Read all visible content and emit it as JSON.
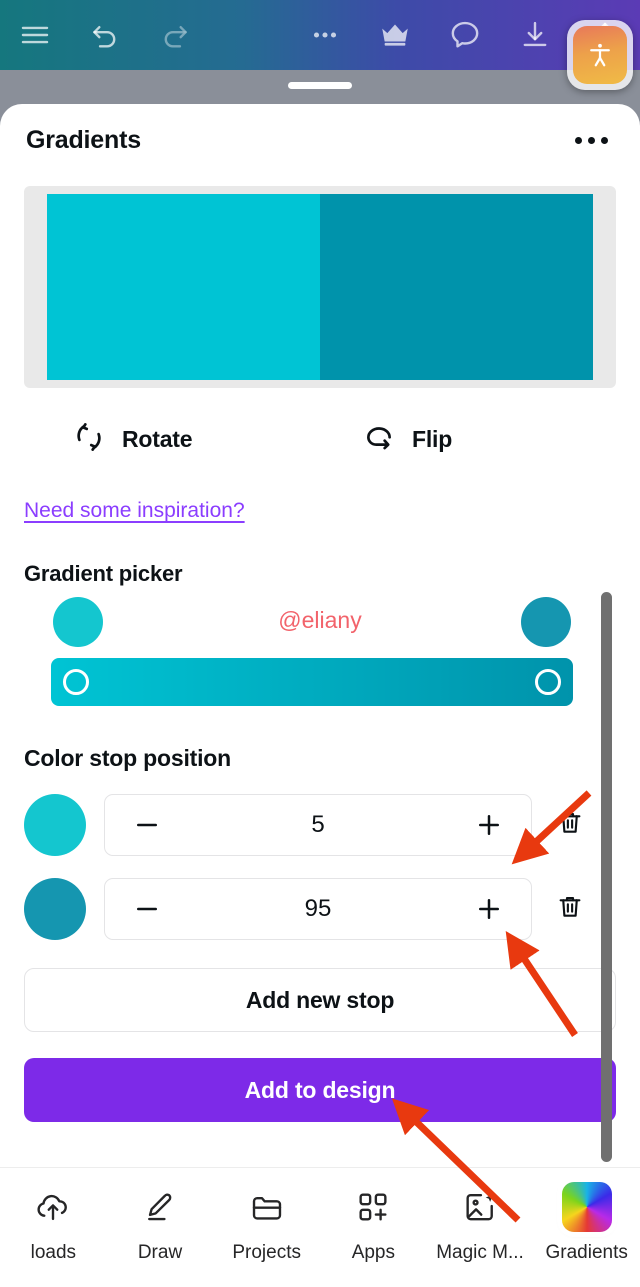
{
  "toolbar": {
    "items": [
      {
        "name": "menu-icon",
        "label": "Menu"
      },
      {
        "name": "undo-icon",
        "label": "Undo"
      },
      {
        "name": "redo-icon",
        "label": "Redo"
      },
      {
        "name": "more-options-icon",
        "label": "More options"
      },
      {
        "name": "crown-icon",
        "label": "Pro"
      },
      {
        "name": "comment-icon",
        "label": "Comments"
      },
      {
        "name": "download-icon",
        "label": "Download"
      },
      {
        "name": "share-icon",
        "label": "Share"
      }
    ],
    "gradient_left": "#15777e",
    "gradient_right": "#5b3bb5"
  },
  "accessibility_fab": {
    "name": "accessibility-button",
    "label": "Accessibility"
  },
  "panel": {
    "title": "Gradients",
    "more_label": "More"
  },
  "preview": {
    "color_left": "#00c4d4",
    "color_right": "#0093ab",
    "hard_stop_percent": 50
  },
  "transform": {
    "rotate_label": "Rotate",
    "flip_label": "Flip"
  },
  "inspiration": {
    "link_text": "Need some inspiration?",
    "color": "#8b3dff"
  },
  "gradient_picker": {
    "title": "Gradient picker",
    "watermark": "@eliany",
    "watermark_color": "#f2636b",
    "stop_left_color": "#14c6cf",
    "stop_right_color": "#1596b0",
    "bar_from": "#00c4d4",
    "bar_to": "#0093ab"
  },
  "color_stop_position": {
    "title": "Color stop position",
    "decrease_label": "Decrease",
    "increase_label": "Increase",
    "delete_label": "Delete",
    "stops": [
      {
        "color": "#14c6cf",
        "value": "5"
      },
      {
        "color": "#1596b0",
        "value": "95"
      }
    ]
  },
  "actions": {
    "add_new_stop": "Add new stop",
    "add_to_design": "Add to design",
    "primary_color": "#7d2ae8"
  },
  "scrollbar": {
    "name": "vertical-scrollbar",
    "color": "#707070"
  },
  "bottom_nav": {
    "items": [
      {
        "label": "loads",
        "icon": "uploads-icon",
        "active": false
      },
      {
        "label": "Draw",
        "icon": "draw-icon",
        "active": false
      },
      {
        "label": "Projects",
        "icon": "projects-icon",
        "active": false
      },
      {
        "label": "Apps",
        "icon": "apps-icon",
        "active": false
      },
      {
        "label": "Magic M...",
        "icon": "magic-media-icon",
        "active": false
      },
      {
        "label": "Gradients",
        "icon": "gradients-icon",
        "active": true
      }
    ]
  },
  "annotations": {
    "arrow_color": "#e8390f",
    "arrows": [
      {
        "name": "arrow-to-increase-stop-1"
      },
      {
        "name": "arrow-to-increase-stop-2"
      },
      {
        "name": "arrow-to-add-to-design"
      }
    ]
  }
}
